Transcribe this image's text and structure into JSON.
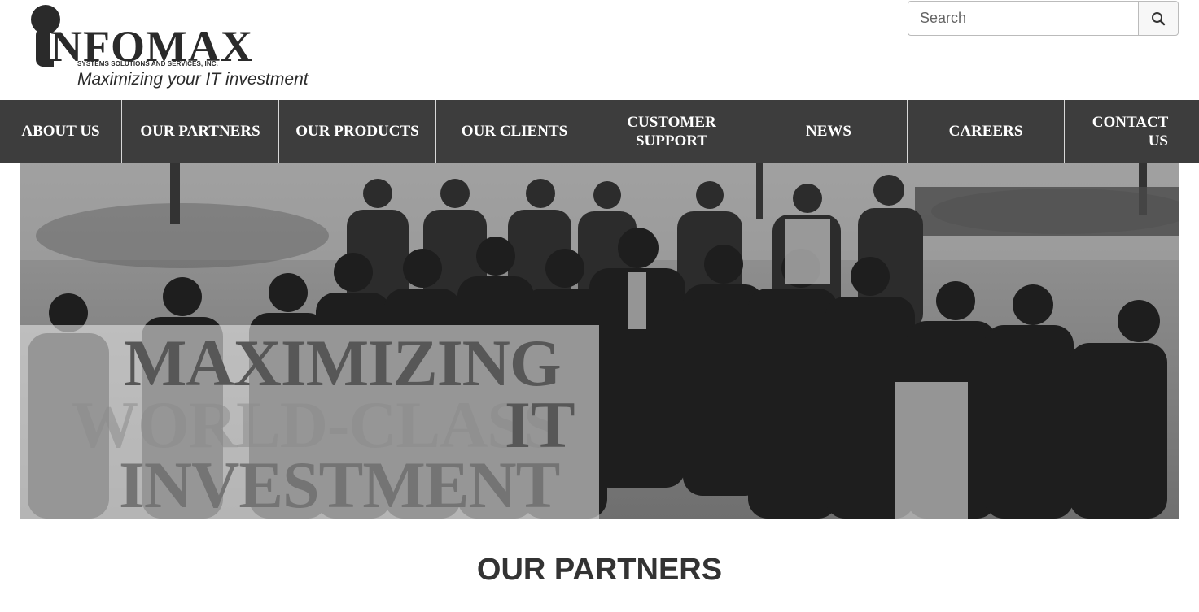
{
  "brand": {
    "name": "NFOMAX",
    "subtitle": "SYSTEMS SOLUTIONS AND SERVICES, INC.",
    "tagline": "Maximizing your IT investment"
  },
  "search": {
    "placeholder": "Search",
    "icon": "search-icon"
  },
  "nav": {
    "items": [
      {
        "label": "ABOUT US"
      },
      {
        "label": "OUR PARTNERS"
      },
      {
        "label": "OUR PRODUCTS"
      },
      {
        "label": "OUR CLIENTS"
      },
      {
        "label": "CUSTOMER SUPPORT"
      },
      {
        "label": "NEWS"
      },
      {
        "label": "CAREERS"
      },
      {
        "label": "CONTACT US"
      }
    ]
  },
  "hero": {
    "line1": "MAXIMIZING",
    "line2": "WORLD-CLASS",
    "line3": "IT",
    "line4": "INVESTMENT"
  },
  "section": {
    "title": "OUR PARTNERS"
  },
  "colors": {
    "nav_background": "#3d3d3d",
    "nav_text": "#ffffff",
    "heading_text": "#333333"
  }
}
